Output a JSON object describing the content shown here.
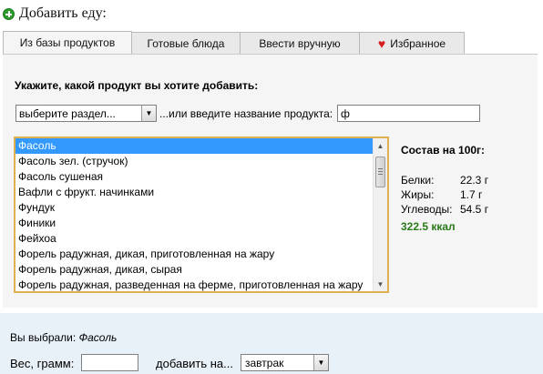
{
  "header": {
    "title": "Добавить еду:"
  },
  "tabs": [
    {
      "label": "Из базы продуктов",
      "active": true
    },
    {
      "label": "Готовые блюда",
      "active": false
    },
    {
      "label": "Ввести вручную",
      "active": false
    },
    {
      "label": "Избранное",
      "active": false,
      "icon": "heart-icon"
    }
  ],
  "search": {
    "prompt": "Укажите, какой продукт вы хотите добавить:",
    "section_select_value": "выберите раздел...",
    "or_label": "...или введите название продукта:",
    "name_input_value": "ф"
  },
  "products": {
    "items": [
      "Фасоль",
      "Фасоль зел. (стручок)",
      "Фасоль сушеная",
      "Вафли с фрукт. начинками",
      "Фундук",
      "Финики",
      "Фейхоа",
      "Форель радужная, дикая, приготовленная на жару",
      "Форель радужная, дикая, сырая",
      "Форель радужная, разведенная на ферме, приготовленная на жару"
    ],
    "selected": "Фасоль"
  },
  "nutrition": {
    "title": "Состав на 100г:",
    "rows": [
      {
        "label": "Белки:",
        "value": "22.3 г"
      },
      {
        "label": "Жиры:",
        "value": "1.7 г"
      },
      {
        "label": "Углеводы:",
        "value": "54.5 г"
      }
    ],
    "kcal": "322.5 ккал"
  },
  "selection": {
    "chosen_label": "Вы выбрали:",
    "chosen_value": "Фасоль",
    "weight_label": "Вес, грамм:",
    "weight_value": "",
    "add_to_label": "добавить на...",
    "meal_value": "завтрак"
  },
  "colors": {
    "selected_row": "#3399ff",
    "kcal_text": "#2a7a1a",
    "list_border": "#e0b050",
    "bottom_panel": "#e8f0f8"
  }
}
